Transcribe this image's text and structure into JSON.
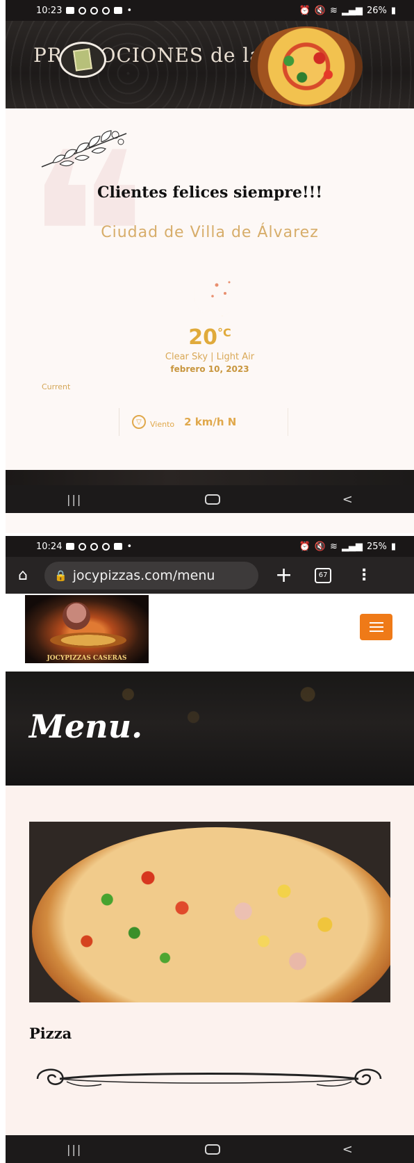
{
  "shot1": {
    "status": {
      "time": "10:23",
      "battery": "26%"
    },
    "banner": {
      "text": "PROMOCIONES de la casa!!"
    },
    "weather": {
      "tagline": "Clientes felices siempre!!!",
      "city": "Ciudad de Villa de Álvarez",
      "temperature": "20",
      "unit": "°C",
      "condition": "Clear Sky | Light Air",
      "date": "febrero 10, 2023",
      "current_label": "Current",
      "wind_label": "Viento",
      "wind_value": "2 km/h N"
    }
  },
  "shot2": {
    "status": {
      "time": "10:24",
      "battery": "25%"
    },
    "browser": {
      "url": "jocypizzas.com/menu",
      "tab_count": "67"
    },
    "site": {
      "logo_text": "JOCYPIZZAS CASERAS",
      "hero_title": "Menu.",
      "item_label": "Pizza"
    }
  },
  "colors": {
    "accent_orange": "#ef7a18",
    "weather_gold": "#e0aa3b"
  }
}
